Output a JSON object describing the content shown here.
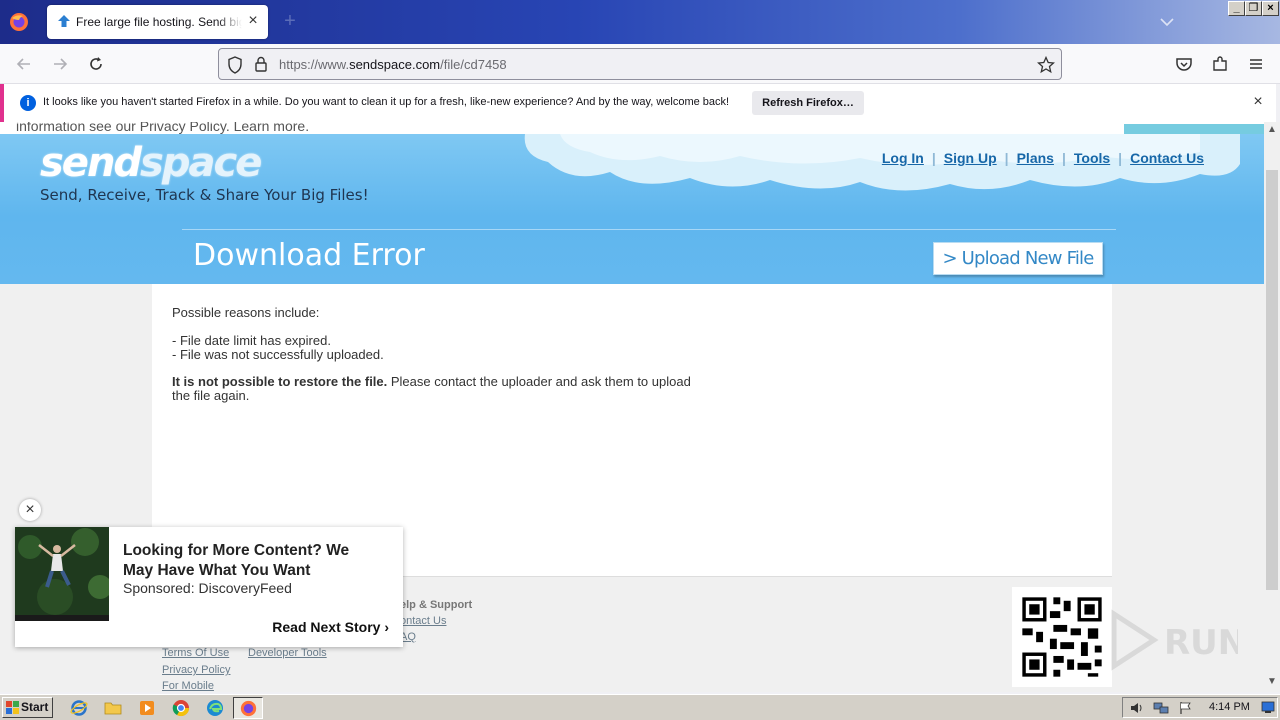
{
  "browser": {
    "tab": {
      "title": "Free large file hosting. Send big files"
    },
    "url": {
      "prefix": "https://www.",
      "domain": "sendspace.com",
      "path": "/file/cd7458"
    },
    "notification": {
      "message": "It looks like you haven't started Firefox in a while. Do you want to clean it up for a fresh, like-new experience? And by the way, welcome back!",
      "button": "Refresh Firefox…"
    }
  },
  "page": {
    "privacy_strip": "information see our Privacy Policy. Learn more.",
    "logo": {
      "part1": "send",
      "part2": "space"
    },
    "tagline": "Send, Receive, Track & Share Your Big Files!",
    "nav": [
      "Log In",
      "Sign Up",
      "Plans",
      "Tools",
      "Contact Us"
    ],
    "heading": "Download Error",
    "upload_button": "> Upload New File",
    "reasons_title": "Possible reasons include:",
    "reasons": [
      "- File date limit has expired.",
      "- File was not successfully uploaded."
    ],
    "restore_bold": "It is not possible to restore the file.",
    "restore_rest": " Please contact the uploader and ask them to upload the file again.",
    "footer": {
      "help_title": "elp & Support",
      "links_col1": [
        "Terms Of Use",
        "Privacy Policy",
        "For Mobile"
      ],
      "links_col2": [
        "Developer Tools"
      ],
      "links_col3": [
        "ontact Us",
        "AQ"
      ]
    }
  },
  "ad": {
    "title": "Looking for More Content? We May Have What You Want",
    "sponsor": "Sponsored: DiscoveryFeed",
    "cta": "Read Next Story"
  },
  "taskbar": {
    "start": "Start",
    "clock": "4:14 PM"
  },
  "colors": {
    "header_blue": "#5fb6ee",
    "nav_link": "#1767a8",
    "notif_accent": "#e0318e",
    "upload_text": "#3388c6"
  }
}
